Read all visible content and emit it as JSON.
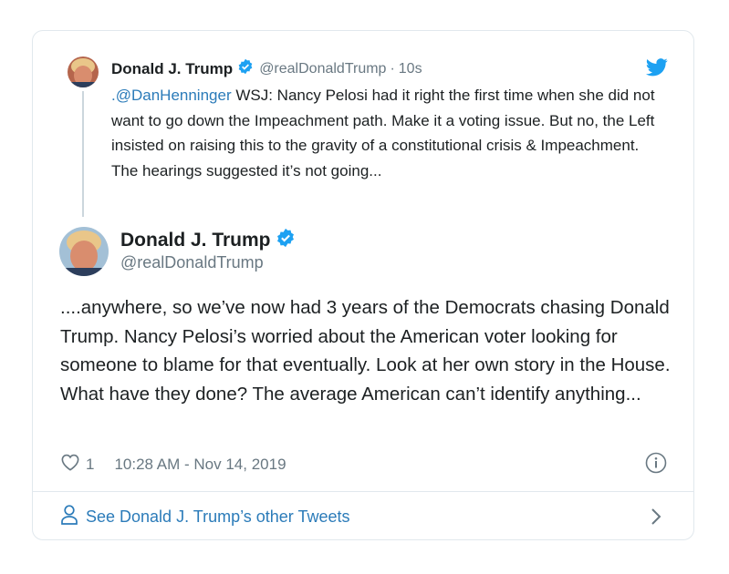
{
  "parent_tweet": {
    "name": "Donald J. Trump",
    "handle": "@realDonaldTrump",
    "separator": "·",
    "time": "10s",
    "mention": ".@DanHenninger",
    "text": " WSJ: Nancy Pelosi had it right the first time when she did not want to go down the Impeachment path. Make it a voting issue. But no, the Left insisted on raising this to the gravity of a constitutional crisis & Impeachment. The hearings suggested it’s not going..."
  },
  "main_tweet": {
    "name": "Donald J. Trump",
    "handle": "@realDonaldTrump",
    "text": "....anywhere, so we’ve now had 3 years of the Democrats chasing Donald Trump. Nancy Pelosi’s worried about the American voter looking for someone to blame for that eventually. Look at her own story in the House. What have they done? The average American can’t identify anything...",
    "like_count": "1",
    "timestamp": "10:28 AM - Nov 14, 2019"
  },
  "footer": {
    "label": "See Donald J. Trump’s other Tweets"
  },
  "icons": {
    "verified": "verified-badge-icon",
    "bird": "twitter-bird-icon",
    "heart": "heart-icon",
    "info": "info-icon",
    "person": "person-icon",
    "chevron": "chevron-right-icon"
  },
  "colors": {
    "link": "#2b7bb9",
    "verified": "#1da1f2",
    "secondary_text": "#697882",
    "border": "#e1e8ed"
  }
}
